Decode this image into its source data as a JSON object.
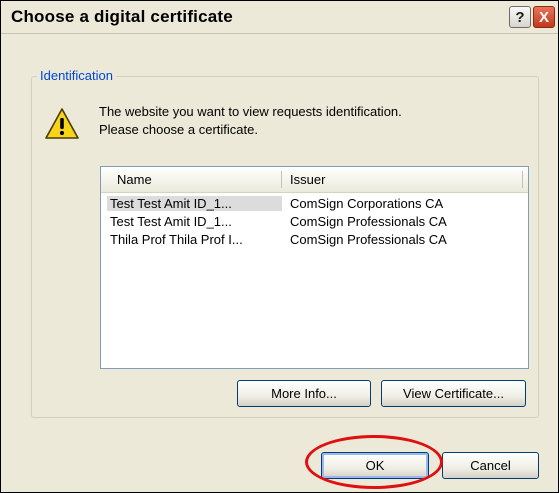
{
  "dialog": {
    "title": "Choose a digital certificate",
    "help_label": "?",
    "close_label": "X",
    "group_label": "Identification",
    "message_line1": "The website you want to view requests identification.",
    "message_line2": "Please choose a certificate."
  },
  "list": {
    "columns": [
      "Name",
      "Issuer"
    ],
    "rows": [
      {
        "name": "Test Test Amit ID_1...",
        "issuer": "ComSign Corporations CA",
        "selected": true
      },
      {
        "name": "Test Test Amit ID_1...",
        "issuer": "ComSign Professionals CA",
        "selected": false
      },
      {
        "name": "Thila Prof Thila Prof I...",
        "issuer": "ComSign Professionals CA",
        "selected": false
      }
    ]
  },
  "buttons": {
    "more_info": "More Info...",
    "view_certificate": "View Certificate...",
    "ok": "OK",
    "cancel": "Cancel"
  },
  "colors": {
    "dialog_background": "#ece9d8",
    "group_label": "#0046d5",
    "highlight": "#e01010",
    "selection": "#dcdcdc"
  },
  "icons": {
    "warning": "warning-icon",
    "help": "help-icon",
    "close": "close-icon"
  }
}
